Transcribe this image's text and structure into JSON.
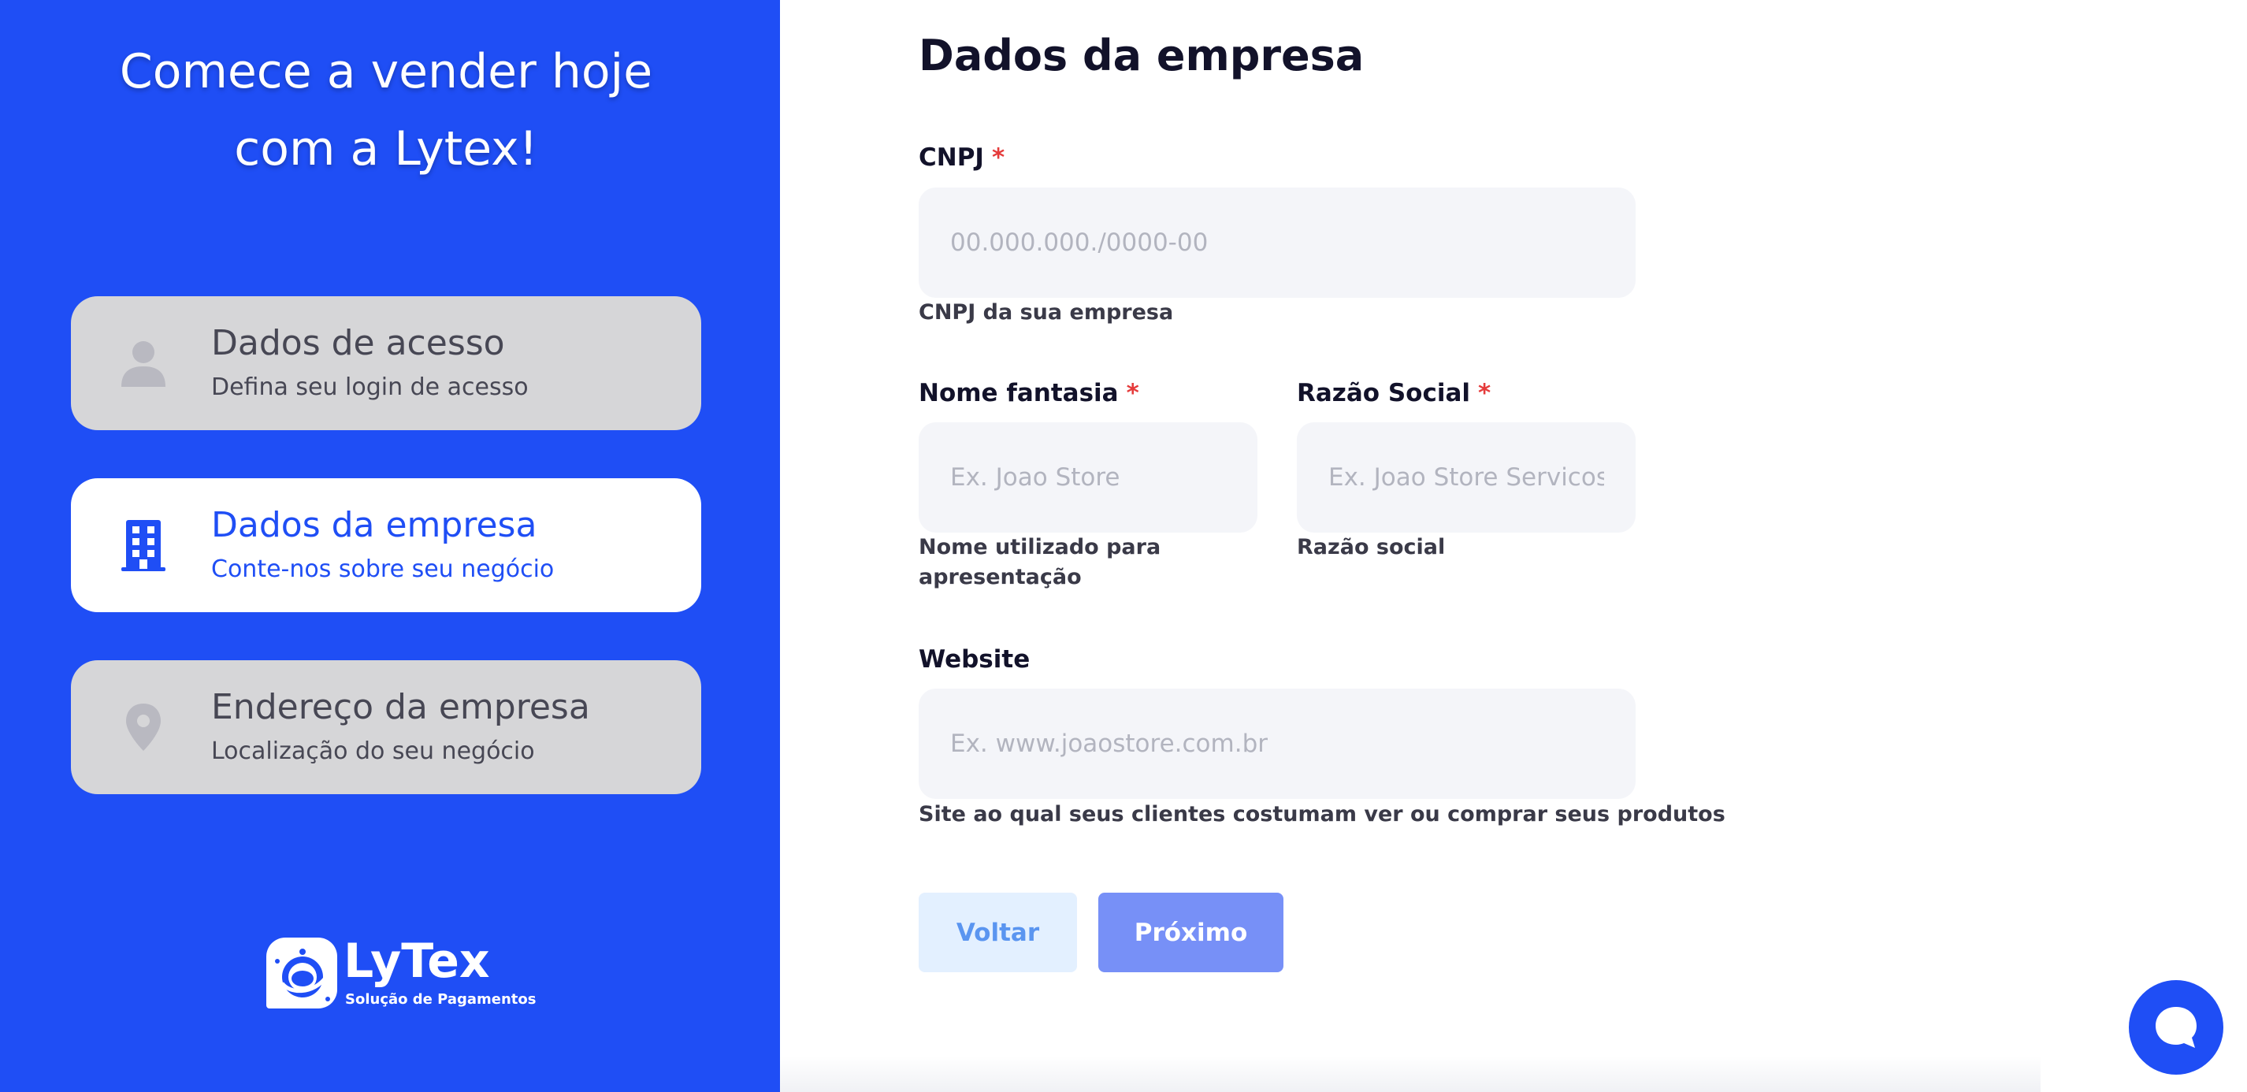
{
  "hero": {
    "line1": "Comece a vender hoje",
    "line2": "com a Lytex!"
  },
  "steps": [
    {
      "title": "Dados de acesso",
      "subtitle": "Defina seu login de acesso",
      "icon": "user-icon",
      "active": false
    },
    {
      "title": "Dados da empresa",
      "subtitle": "Conte-nos sobre seu negócio",
      "icon": "building-icon",
      "active": true
    },
    {
      "title": "Endereço da empresa",
      "subtitle": "Localização do seu negócio",
      "icon": "location-pin-icon",
      "active": false
    }
  ],
  "logo": {
    "name": "LyTex",
    "tagline": "Solução de Pagamentos"
  },
  "form": {
    "title": "Dados da empresa",
    "required_mark": "*",
    "cnpj": {
      "label": "CNPJ",
      "placeholder": "00.000.000./0000-00",
      "value": "",
      "hint": "CNPJ da sua empresa"
    },
    "nome_fantasia": {
      "label": "Nome fantasia",
      "placeholder": "Ex. Joao Store",
      "value": "",
      "hint_line1": "Nome utilizado para",
      "hint_line2": "apresentação"
    },
    "razao_social": {
      "label": "Razão Social",
      "placeholder": "Ex. Joao Store Servicos",
      "value": "",
      "hint": "Razão social"
    },
    "website": {
      "label": "Website",
      "placeholder": "Ex. www.joaostore.com.br",
      "value": "",
      "hint": "Site ao qual seus clientes costumam ver ou comprar seus produtos"
    }
  },
  "buttons": {
    "back": "Voltar",
    "next": "Próximo"
  },
  "colors": {
    "brand": "#1f4ef5",
    "inactive_step": "#d6d6d8",
    "required": "#e53b3b",
    "next_button": "#7790f7",
    "back_button": "#e3f0ff"
  }
}
